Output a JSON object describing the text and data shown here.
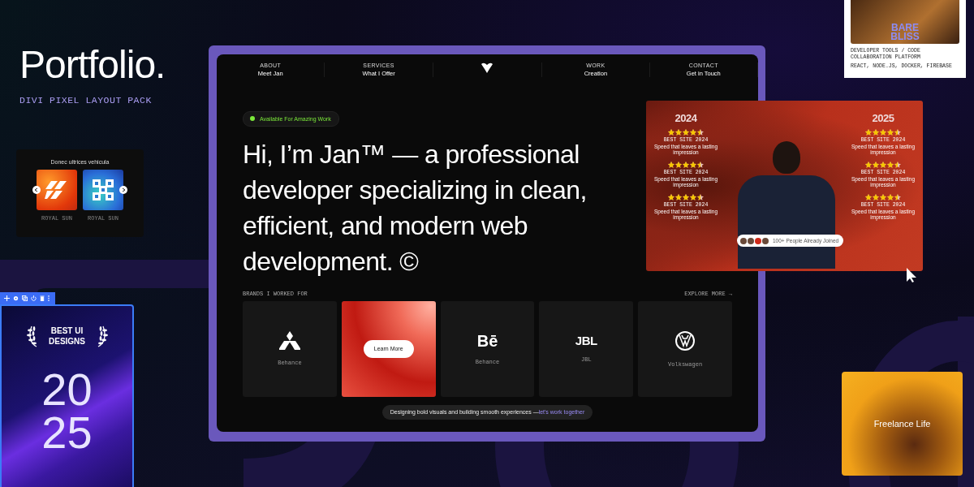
{
  "intro": {
    "title": "Portfolio.",
    "subtitle": "DIVI PIXEL LAYOUT PACK"
  },
  "slider_card": {
    "title": "Donec ultrices vehicula",
    "items": [
      {
        "caption": "ROYAL SUN"
      },
      {
        "caption": "ROYAL SUN"
      }
    ]
  },
  "award_card": {
    "title": "BEST UI DESIGNS",
    "year_lines": [
      "20",
      "25"
    ]
  },
  "site": {
    "nav_left": [
      {
        "label": "ABOUT",
        "title": "Meet Jan"
      },
      {
        "label": "SERVICES",
        "title": "What I Offer"
      }
    ],
    "nav_right": [
      {
        "label": "WORK",
        "title": "Creation"
      },
      {
        "label": "CONTACT",
        "title": "Get in Touch"
      }
    ],
    "status_badge": "Available For Amazing Work",
    "headline": "Hi, I’m Jan™ — a professional developer specializing in clean, efficient, and modern web development. ©",
    "brands_label": "BRANDS I WORKED FOR",
    "explore_link": "EXPLORE MORE →",
    "brands": [
      {
        "kind": "logo",
        "caption": "Behance"
      },
      {
        "kind": "image",
        "button": "Learn More"
      },
      {
        "kind": "logo",
        "logo_text": "Bē",
        "caption": "Behance"
      },
      {
        "kind": "logo",
        "logo_text": "JBL",
        "caption": "JBL"
      },
      {
        "kind": "logo",
        "caption": "Volkswagen"
      }
    ],
    "footer_text": "Designing bold visuals and building smooth experiences — ",
    "footer_link": "let's work together"
  },
  "hero_card": {
    "columns": [
      {
        "year": "2024",
        "reviews": [
          {
            "stars": 4.5,
            "label": "BEST SITE 2024",
            "text": "Speed that leaves a lasting impression"
          },
          {
            "stars": 4.5,
            "label": "BEST SITE 2024",
            "text": "Speed that leaves a lasting impression"
          },
          {
            "stars": 4.5,
            "label": "BEST SITE 2024",
            "text": "Speed that leaves a lasting impression"
          }
        ]
      },
      {
        "year": "2025",
        "reviews": [
          {
            "stars": 4.5,
            "label": "BEST SITE 2024",
            "text": "Speed that leaves a lasting impression"
          },
          {
            "stars": 4.5,
            "label": "BEST SITE 2024",
            "text": "Speed that leaves a lasting impression"
          },
          {
            "stars": 4.5,
            "label": "BEST SITE 2024",
            "text": "Speed that leaves a lasting impression"
          }
        ]
      }
    ],
    "joined_text": "100+ People Already Joined"
  },
  "project_card": {
    "logo_lines": [
      "BARE",
      "BLISS"
    ],
    "category": "DEVELOPER TOOLS / CODE COLLABORATION PLATFORM",
    "stack": "REACT, NODE.JS, DOCKER, FIREBASE"
  },
  "freelance_card": {
    "title": "Freelance Life"
  }
}
